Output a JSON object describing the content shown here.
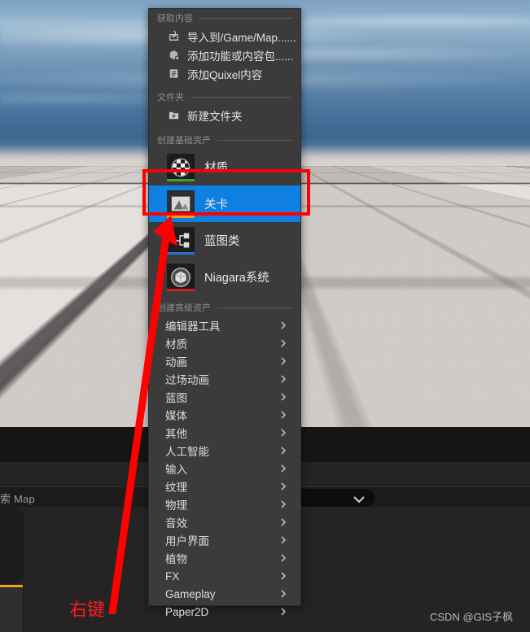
{
  "viewport": {
    "name": "unreal-3d-viewport"
  },
  "editor_panel": {
    "search_text": "索 Map",
    "dropdown_value": ""
  },
  "context_menu": {
    "sections": [
      {
        "header": "获取内容",
        "items": [
          {
            "icon": "import-icon",
            "label": "导入到/Game/Map......"
          },
          {
            "icon": "add-feature-icon",
            "label": "添加功能或内容包......"
          },
          {
            "icon": "quixel-icon",
            "label": "添加Quixel内容"
          }
        ]
      },
      {
        "header": "文件夹",
        "items": [
          {
            "icon": "new-folder-icon",
            "label": "新建文件夹"
          }
        ]
      }
    ],
    "basic_assets": {
      "header": "创建基础资产",
      "items": [
        {
          "icon": "material-sphere-icon",
          "label": "材质",
          "bar_color": "#3aa33a",
          "selected": false
        },
        {
          "icon": "level-icon",
          "label": "关卡",
          "bar_color": "#f0a01c",
          "selected": true
        },
        {
          "icon": "blueprint-class-icon",
          "label": "蓝图类",
          "bar_color": "#2b6fd4",
          "selected": false
        },
        {
          "icon": "niagara-system-icon",
          "label": "Niagara系统",
          "bar_color": "#cf2020",
          "selected": false
        }
      ]
    },
    "advanced_assets": {
      "header": "创建高级资产",
      "items": [
        {
          "label": "编辑器工具"
        },
        {
          "label": "材质"
        },
        {
          "label": "动画"
        },
        {
          "label": "过场动画"
        },
        {
          "label": "蓝图"
        },
        {
          "label": "媒体"
        },
        {
          "label": "其他"
        },
        {
          "label": "人工智能"
        },
        {
          "label": "输入"
        },
        {
          "label": "纹理"
        },
        {
          "label": "物理"
        },
        {
          "label": "音效"
        },
        {
          "label": "用户界面"
        },
        {
          "label": "植物"
        },
        {
          "label": "FX"
        },
        {
          "label": "Gameplay"
        },
        {
          "label": "Paper2D"
        }
      ]
    }
  },
  "annotations": {
    "right_click_label": "右键",
    "highlight_color": "#ff0000",
    "arrow_color": "#ff0000"
  },
  "watermark": {
    "text": "CSDN @GIS子枫"
  }
}
